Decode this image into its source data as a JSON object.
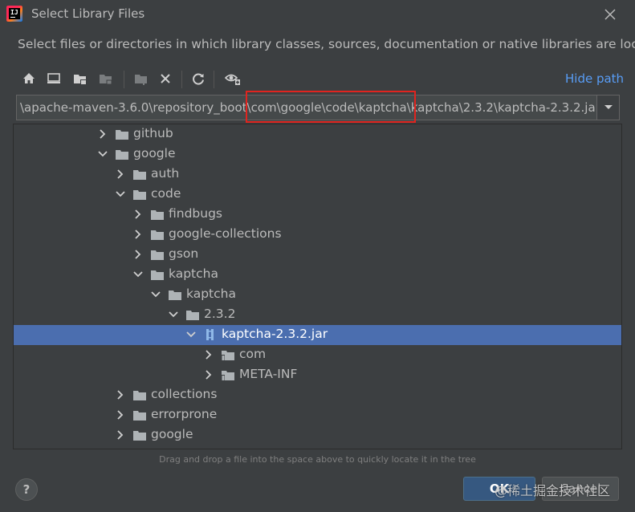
{
  "window": {
    "title": "Select Library Files",
    "description": "Select files or directories in which library classes, sources, documentation or native libraries are located"
  },
  "toolbar": {
    "hide_path_label": "Hide path",
    "icons": [
      "home-icon",
      "desktop-icon",
      "project-folder-icon",
      "module-folder-icon",
      "new-folder-icon",
      "delete-icon",
      "refresh-icon",
      "show-hidden-icon"
    ]
  },
  "path": {
    "value": "\\apache-maven-3.6.0\\repository_boot\\com\\google\\code\\kaptcha\\kaptcha\\2.3.2\\kaptcha-2.3.2.jar"
  },
  "tree": {
    "rows": [
      {
        "label": "github",
        "expanded": false,
        "icon": "folder-icon"
      },
      {
        "label": "google",
        "expanded": true,
        "icon": "folder-icon"
      },
      {
        "label": "auth",
        "expanded": false,
        "icon": "folder-icon"
      },
      {
        "label": "code",
        "expanded": true,
        "icon": "folder-icon"
      },
      {
        "label": "findbugs",
        "expanded": false,
        "icon": "folder-icon"
      },
      {
        "label": "google-collections",
        "expanded": false,
        "icon": "folder-icon"
      },
      {
        "label": "gson",
        "expanded": false,
        "icon": "folder-icon"
      },
      {
        "label": "kaptcha",
        "expanded": true,
        "icon": "folder-icon"
      },
      {
        "label": "kaptcha",
        "expanded": true,
        "icon": "folder-icon"
      },
      {
        "label": "2.3.2",
        "expanded": true,
        "icon": "folder-icon"
      },
      {
        "label": "kaptcha-2.3.2.jar",
        "expanded": true,
        "icon": "jar-icon",
        "selected": true
      },
      {
        "label": "com",
        "expanded": false,
        "icon": "package-folder-icon"
      },
      {
        "label": "META-INF",
        "expanded": false,
        "icon": "package-folder-icon"
      },
      {
        "label": "collections",
        "expanded": false,
        "icon": "folder-icon"
      },
      {
        "label": "errorprone",
        "expanded": false,
        "icon": "folder-icon"
      },
      {
        "label": "google",
        "expanded": false,
        "icon": "folder-icon"
      }
    ]
  },
  "hint": "Drag and drop a file into the space above to quickly locate it in the tree",
  "buttons": {
    "help": "?",
    "ok": "OK",
    "cancel": "Cancel"
  },
  "watermark": "@稀土掘金技术社区",
  "colors": {
    "background": "#3c3f41",
    "selection": "#4b6eaf",
    "link": "#589df6",
    "highlight_box": "#e0241f",
    "ok_button": "#365880"
  }
}
